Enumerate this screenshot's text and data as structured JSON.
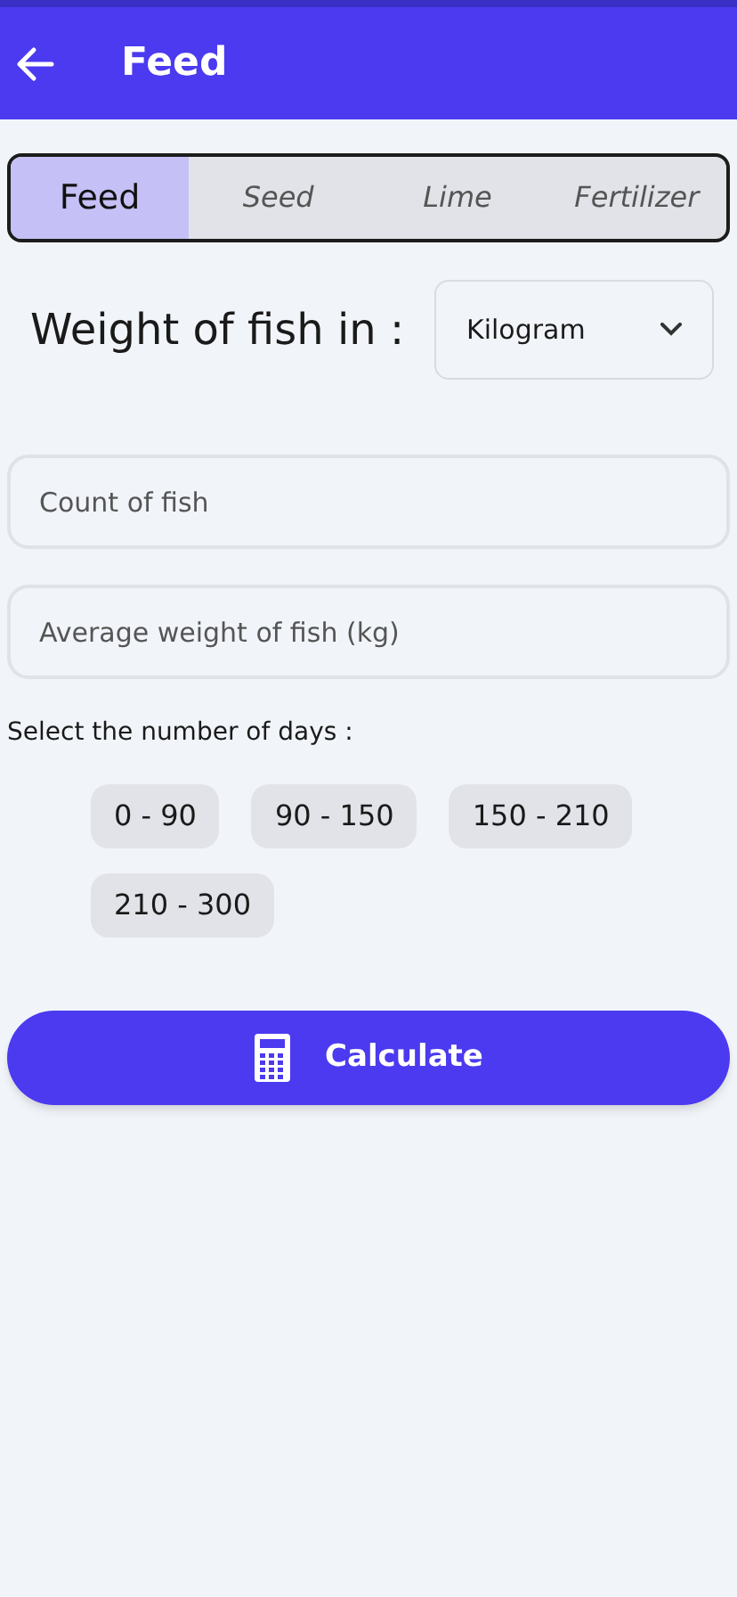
{
  "header": {
    "title": "Feed"
  },
  "tabs": [
    {
      "label": "Feed",
      "selected": true
    },
    {
      "label": "Seed",
      "selected": false
    },
    {
      "label": "Lime",
      "selected": false
    },
    {
      "label": "Fertilizer",
      "selected": false
    }
  ],
  "unit": {
    "label": "Weight of fish in :",
    "value": "Kilogram"
  },
  "fields": [
    {
      "placeholder": "Count of fish"
    },
    {
      "placeholder": "Average weight of fish (kg)"
    }
  ],
  "days": {
    "label": "Select the number of days :",
    "options": [
      {
        "label": "0 - 90",
        "selected": false
      },
      {
        "label": "90 - 150",
        "selected": false
      },
      {
        "label": "150 - 210",
        "selected": false
      },
      {
        "label": "210 - 300",
        "selected": false
      }
    ]
  },
  "button": {
    "label": "Calculate"
  }
}
